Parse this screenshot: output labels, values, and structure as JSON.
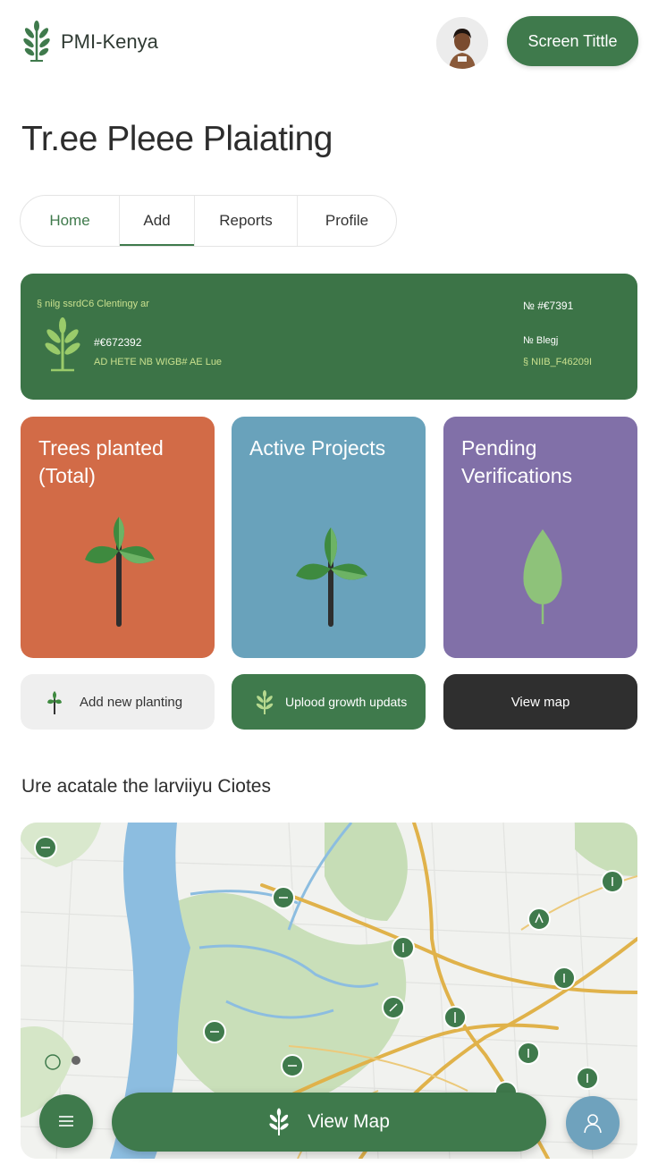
{
  "header": {
    "brand_name": "PMI-Kenya",
    "title_button": "Screen Tittle"
  },
  "page_title": "Tr.ee Pleee Plaiating",
  "tabs": [
    {
      "label": "Home",
      "active": false
    },
    {
      "label": "Add",
      "active": true
    },
    {
      "label": "Reports",
      "active": false
    },
    {
      "label": "Profile",
      "active": false
    }
  ],
  "banner": {
    "caption": "§ nilg ssrdC6 Clentingy ar",
    "code_left": "#€672392",
    "subtext": "AD HETE NB WIGB# AE Lue",
    "right_line1": "№ #€7391",
    "right_line2": "№ Blegj",
    "right_line3": "§ NIIB_F46209I"
  },
  "stats": [
    {
      "label": "Trees planted (Total)",
      "color": "#d26b47"
    },
    {
      "label": "Active Projects",
      "color": "#69a2bb"
    },
    {
      "label": "Pending Verifications",
      "color": "#8170a8"
    }
  ],
  "actions": {
    "add_planting": "Add new planting",
    "upload_updates": "Uplood growth updats",
    "view_map": "View map"
  },
  "section_title": "Ure acatale the larviiyu Ciotes",
  "bottom_bar": {
    "view_map_label": "View Map"
  },
  "colors": {
    "primary_green": "#3f7a4c",
    "orange": "#d26b47",
    "blue": "#69a2bb",
    "purple": "#8170a8",
    "dark": "#2f2f2f"
  }
}
